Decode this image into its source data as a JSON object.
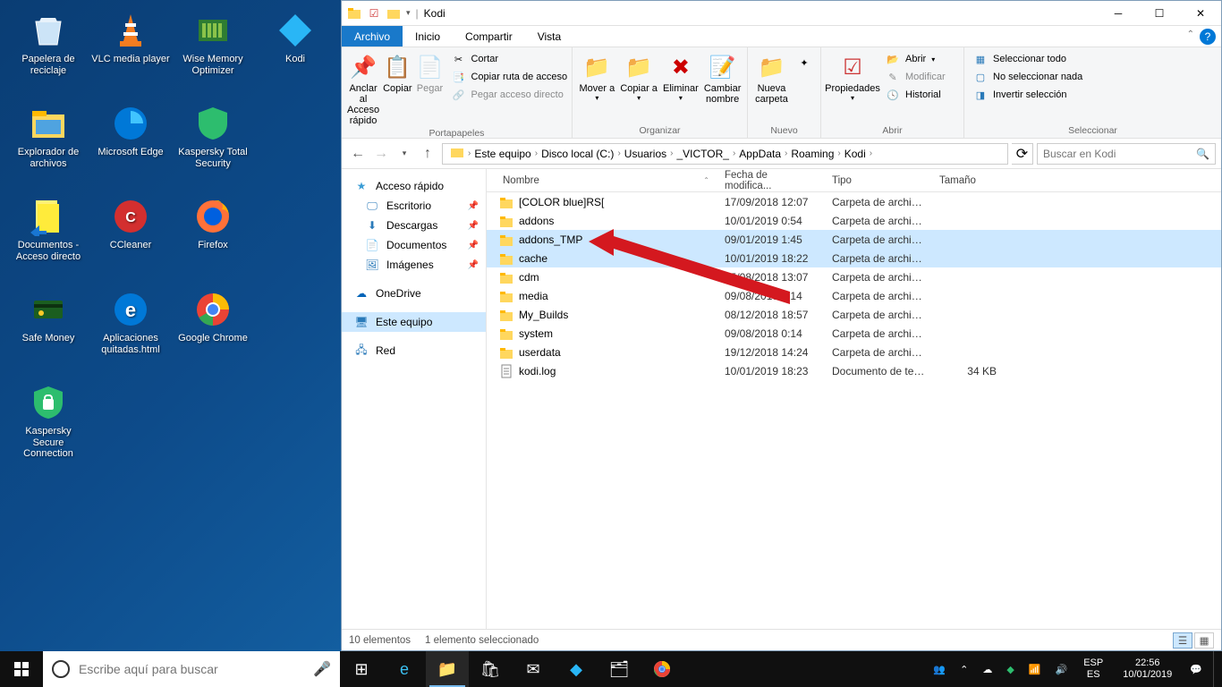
{
  "desktop": {
    "icons": [
      {
        "label": "Papelera de reciclaje",
        "glyph": "recycle"
      },
      {
        "label": "VLC media player",
        "glyph": "vlc"
      },
      {
        "label": "Wise Memory Optimizer",
        "glyph": "wise"
      },
      {
        "label": "Kodi",
        "glyph": "kodi"
      },
      {
        "label": "Explorador de archivos",
        "glyph": "explorer"
      },
      {
        "label": "Microsoft Edge",
        "glyph": "edge"
      },
      {
        "label": "Kaspersky Total Security",
        "glyph": "kaspersky"
      },
      {
        "label": "",
        "glyph": ""
      },
      {
        "label": "Documentos - Acceso directo",
        "glyph": "docshortcut"
      },
      {
        "label": "CCleaner",
        "glyph": "ccleaner"
      },
      {
        "label": "Firefox",
        "glyph": "firefox"
      },
      {
        "label": "",
        "glyph": ""
      },
      {
        "label": "Safe Money",
        "glyph": "safemoney"
      },
      {
        "label": "Aplicaciones quitadas.html",
        "glyph": "edgefile"
      },
      {
        "label": "Google Chrome",
        "glyph": "chrome"
      },
      {
        "label": "",
        "glyph": ""
      },
      {
        "label": "Kaspersky Secure Connection",
        "glyph": "ksecure"
      }
    ]
  },
  "window": {
    "title": "Kodi",
    "menutabs": {
      "archivo": "Archivo",
      "inicio": "Inicio",
      "compartir": "Compartir",
      "vista": "Vista"
    },
    "ribbon": {
      "portapapeles": {
        "label": "Portapapeles",
        "anclar": "Anclar al Acceso rápido",
        "copiar": "Copiar",
        "pegar": "Pegar",
        "cortar": "Cortar",
        "copiar_ruta": "Copiar ruta de acceso",
        "pegar_acceso": "Pegar acceso directo"
      },
      "organizar": {
        "label": "Organizar",
        "mover": "Mover a",
        "copiar": "Copiar a",
        "eliminar": "Eliminar",
        "cambiar": "Cambiar nombre"
      },
      "nuevo": {
        "label": "Nuevo",
        "nueva_carpeta": "Nueva carpeta"
      },
      "abrir": {
        "label": "Abrir",
        "propiedades": "Propiedades",
        "abrir": "Abrir",
        "modificar": "Modificar",
        "historial": "Historial"
      },
      "seleccionar": {
        "label": "Seleccionar",
        "todo": "Seleccionar todo",
        "nada": "No seleccionar nada",
        "invertir": "Invertir selección"
      }
    },
    "breadcrumb": [
      "Este equipo",
      "Disco local (C:)",
      "Usuarios",
      "_VICTOR_",
      "AppData",
      "Roaming",
      "Kodi"
    ],
    "search_placeholder": "Buscar en Kodi",
    "navpane": {
      "acceso_rapido": "Acceso rápido",
      "escritorio": "Escritorio",
      "descargas": "Descargas",
      "documentos": "Documentos",
      "imagenes": "Imágenes",
      "onedrive": "OneDrive",
      "este_equipo": "Este equipo",
      "red": "Red"
    },
    "columns": {
      "nombre": "Nombre",
      "fecha": "Fecha de modifica...",
      "tipo": "Tipo",
      "tamano": "Tamaño"
    },
    "rows": [
      {
        "name": "[COLOR blue]RS[",
        "date": "17/09/2018 12:07",
        "type": "Carpeta de archivos",
        "size": "",
        "kind": "folder",
        "selected": false
      },
      {
        "name": "addons",
        "date": "10/01/2019 0:54",
        "type": "Carpeta de archivos",
        "size": "",
        "kind": "folder",
        "selected": false
      },
      {
        "name": "addons_TMP",
        "date": "09/01/2019 1:45",
        "type": "Carpeta de archivos",
        "size": "",
        "kind": "folder",
        "selected": true
      },
      {
        "name": "cache",
        "date": "10/01/2019 18:22",
        "type": "Carpeta de archivos",
        "size": "",
        "kind": "folder",
        "selected": false,
        "checked": true
      },
      {
        "name": "cdm",
        "date": "15/08/2018 13:07",
        "type": "Carpeta de archivos",
        "size": "",
        "kind": "folder",
        "selected": false
      },
      {
        "name": "media",
        "date": "09/08/2018 0:14",
        "type": "Carpeta de archivos",
        "size": "",
        "kind": "folder",
        "selected": false
      },
      {
        "name": "My_Builds",
        "date": "08/12/2018 18:57",
        "type": "Carpeta de archivos",
        "size": "",
        "kind": "folder",
        "selected": false
      },
      {
        "name": "system",
        "date": "09/08/2018 0:14",
        "type": "Carpeta de archivos",
        "size": "",
        "kind": "folder",
        "selected": false
      },
      {
        "name": "userdata",
        "date": "19/12/2018 14:24",
        "type": "Carpeta de archivos",
        "size": "",
        "kind": "folder",
        "selected": false
      },
      {
        "name": "kodi.log",
        "date": "10/01/2019 18:23",
        "type": "Documento de tex...",
        "size": "34 KB",
        "kind": "file",
        "selected": false
      }
    ],
    "status": {
      "count": "10 elementos",
      "selected": "1 elemento seleccionado"
    }
  },
  "taskbar": {
    "search_placeholder": "Escribe aquí para buscar",
    "lang1": "ESP",
    "lang2": "ES",
    "time": "22:56",
    "date": "10/01/2019"
  }
}
